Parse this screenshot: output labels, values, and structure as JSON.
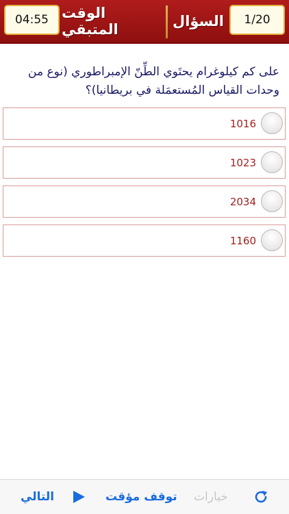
{
  "header": {
    "time_value": "04:55",
    "time_label": "الوقت المتبقي",
    "question_label": "السؤال",
    "progress": "1/20"
  },
  "question": {
    "text": "على كم كيلوغرام يحتَوي الطِّنّ الإمبراطوري (نوع من وحدات القياس المُستعمَلة في بريطانيا)؟"
  },
  "options": [
    {
      "label": "1016"
    },
    {
      "label": "1023"
    },
    {
      "label": "2034"
    },
    {
      "label": "1160"
    }
  ],
  "toolbar": {
    "next": "التالي",
    "pause": "توقف مؤقت",
    "options": "خيارات"
  },
  "colors": {
    "header_red": "#a01616",
    "accent_gold": "#e4b23b",
    "option_text": "#a31f1f",
    "toolbar_blue": "#1a6bdf"
  }
}
